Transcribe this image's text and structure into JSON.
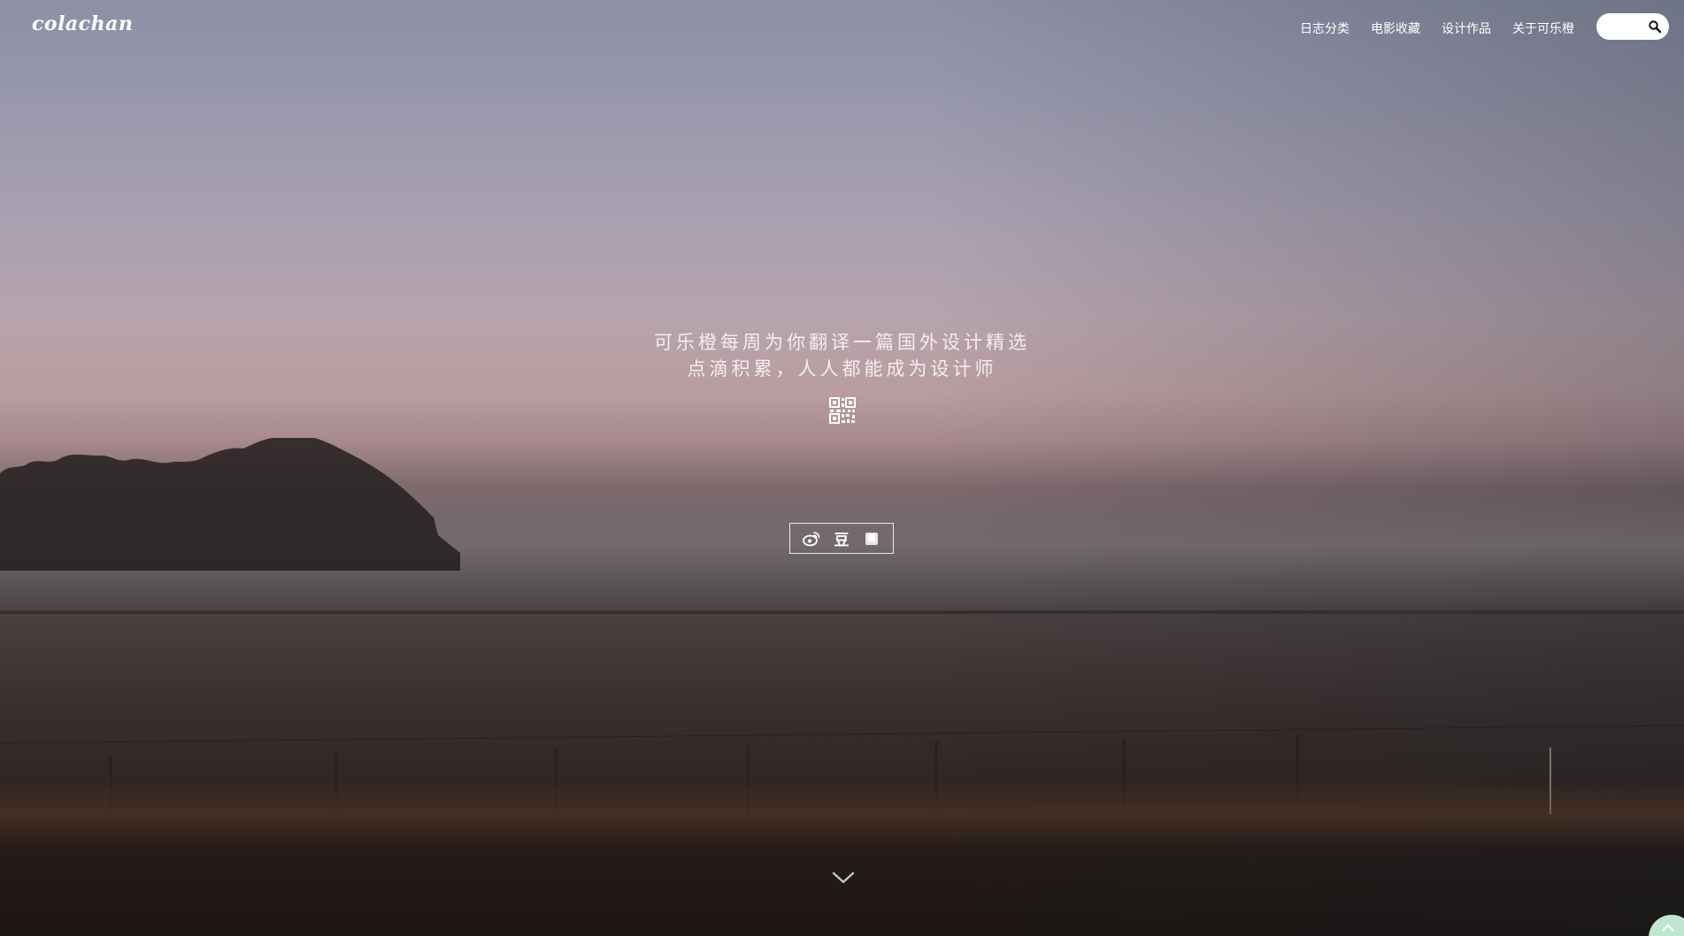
{
  "header": {
    "logo": "colachan",
    "nav": [
      {
        "label": "日志分类"
      },
      {
        "label": "电影收藏"
      },
      {
        "label": "设计作品"
      },
      {
        "label": "关于可乐橙"
      }
    ],
    "search": {
      "placeholder": "",
      "value": "",
      "icon": "search-icon"
    }
  },
  "hero": {
    "tagline_line1": "可乐橙每周为你翻译一篇国外设计精选",
    "tagline_line2": "点滴积累，人人都能成为设计师",
    "qr_icon": "qr-code-icon",
    "social": [
      {
        "icon": "weibo-icon"
      },
      {
        "icon": "douban-icon",
        "glyph": "豆"
      },
      {
        "icon": "wechat-icon"
      }
    ],
    "scroll_icon": "chevron-down-icon",
    "back_to_top_icon": "arrow-up-icon"
  },
  "colors": {
    "text": "#ffffff",
    "search_bg": "#ffffff",
    "back_to_top": "#bfe6cf"
  }
}
